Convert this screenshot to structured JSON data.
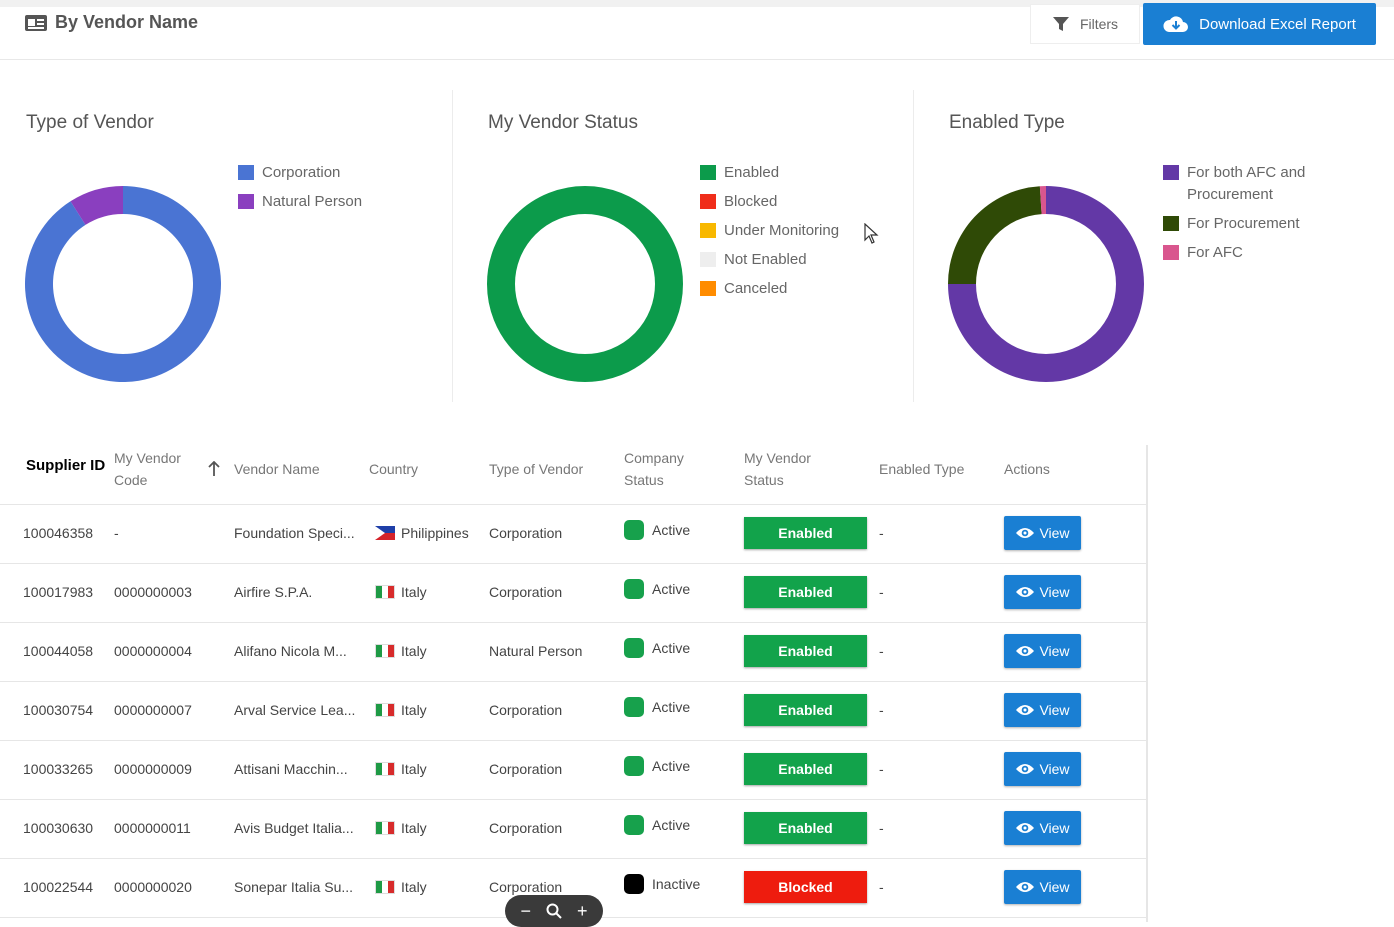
{
  "header": {
    "title": "By Vendor Name",
    "filters_label": "Filters",
    "download_label": "Download Excel Report",
    "colors": {
      "primary": "#1a7fd3"
    }
  },
  "charts": {
    "type_of_vendor": {
      "title": "Type of Vendor",
      "legend": [
        {
          "label": "Corporation",
          "color": "#4a74d3"
        },
        {
          "label": "Natural Person",
          "color": "#8a3fbf"
        }
      ]
    },
    "vendor_status": {
      "title": "My Vendor Status",
      "legend": [
        {
          "label": "Enabled",
          "color": "#0c9b4b"
        },
        {
          "label": "Blocked",
          "color": "#f02d1a"
        },
        {
          "label": "Under Monitoring",
          "color": "#f8b800"
        },
        {
          "label": "Not Enabled",
          "color": "#eeeeee"
        },
        {
          "label": "Canceled",
          "color": "#ff8c00"
        }
      ]
    },
    "enabled_type": {
      "title": "Enabled Type",
      "legend": [
        {
          "label": "For both AFC and Procurement",
          "color": "#6338a6"
        },
        {
          "label": "For Procurement",
          "color": "#2f4a06"
        },
        {
          "label": "For AFC",
          "color": "#d9568e"
        }
      ]
    }
  },
  "chart_data": [
    {
      "type": "pie",
      "title": "Type of Vendor",
      "categories": [
        "Corporation",
        "Natural Person"
      ],
      "values": [
        91,
        9
      ]
    },
    {
      "type": "pie",
      "title": "My Vendor Status",
      "categories": [
        "Enabled",
        "Blocked",
        "Under Monitoring",
        "Not Enabled",
        "Canceled"
      ],
      "values": [
        100,
        0,
        0,
        0,
        0
      ]
    },
    {
      "type": "pie",
      "title": "Enabled Type",
      "categories": [
        "For both AFC and Procurement",
        "For Procurement",
        "For AFC"
      ],
      "values": [
        75,
        24,
        1
      ]
    }
  ],
  "table": {
    "columns": {
      "supplier_id": "Supplier ID",
      "vendor_code": "My Vendor Code",
      "vendor_name": "Vendor Name",
      "country": "Country",
      "type": "Type of Vendor",
      "company_status": "Company Status",
      "my_status": "My Vendor Status",
      "enabled_type": "Enabled Type",
      "actions": "Actions"
    },
    "view_label": "View",
    "rows": [
      {
        "id": "100046358",
        "code": "-",
        "name": "Foundation Speci...",
        "country": "Philippines",
        "flag": "ph",
        "type": "Corporation",
        "company_status": "Active",
        "company_color": "#17a14c",
        "my_status": "Enabled",
        "my_status_color": "#12a34b",
        "enabled_type": "-"
      },
      {
        "id": "100017983",
        "code": "0000000003",
        "name": "Airfire S.P.A.",
        "country": "Italy",
        "flag": "it",
        "type": "Corporation",
        "company_status": "Active",
        "company_color": "#17a14c",
        "my_status": "Enabled",
        "my_status_color": "#12a34b",
        "enabled_type": "-"
      },
      {
        "id": "100044058",
        "code": "0000000004",
        "name": "Alifano Nicola M...",
        "country": "Italy",
        "flag": "it",
        "type": "Natural Person",
        "company_status": "Active",
        "company_color": "#17a14c",
        "my_status": "Enabled",
        "my_status_color": "#12a34b",
        "enabled_type": "-"
      },
      {
        "id": "100030754",
        "code": "0000000007",
        "name": "Arval Service Lea...",
        "country": "Italy",
        "flag": "it",
        "type": "Corporation",
        "company_status": "Active",
        "company_color": "#17a14c",
        "my_status": "Enabled",
        "my_status_color": "#12a34b",
        "enabled_type": "-"
      },
      {
        "id": "100033265",
        "code": "0000000009",
        "name": "Attisani Macchin...",
        "country": "Italy",
        "flag": "it",
        "type": "Corporation",
        "company_status": "Active",
        "company_color": "#17a14c",
        "my_status": "Enabled",
        "my_status_color": "#12a34b",
        "enabled_type": "-"
      },
      {
        "id": "100030630",
        "code": "0000000011",
        "name": "Avis Budget Italia...",
        "country": "Italy",
        "flag": "it",
        "type": "Corporation",
        "company_status": "Active",
        "company_color": "#17a14c",
        "my_status": "Enabled",
        "my_status_color": "#12a34b",
        "enabled_type": "-"
      },
      {
        "id": "100022544",
        "code": "0000000020",
        "name": "Sonepar Italia Su...",
        "country": "Italy",
        "flag": "it",
        "type": "Corporation",
        "company_status": "Inactive",
        "company_color": "#000000",
        "my_status": "Blocked",
        "my_status_color": "#ee1c0e",
        "enabled_type": "-"
      }
    ]
  },
  "zoom": {
    "minus": "−",
    "plus": "+"
  }
}
